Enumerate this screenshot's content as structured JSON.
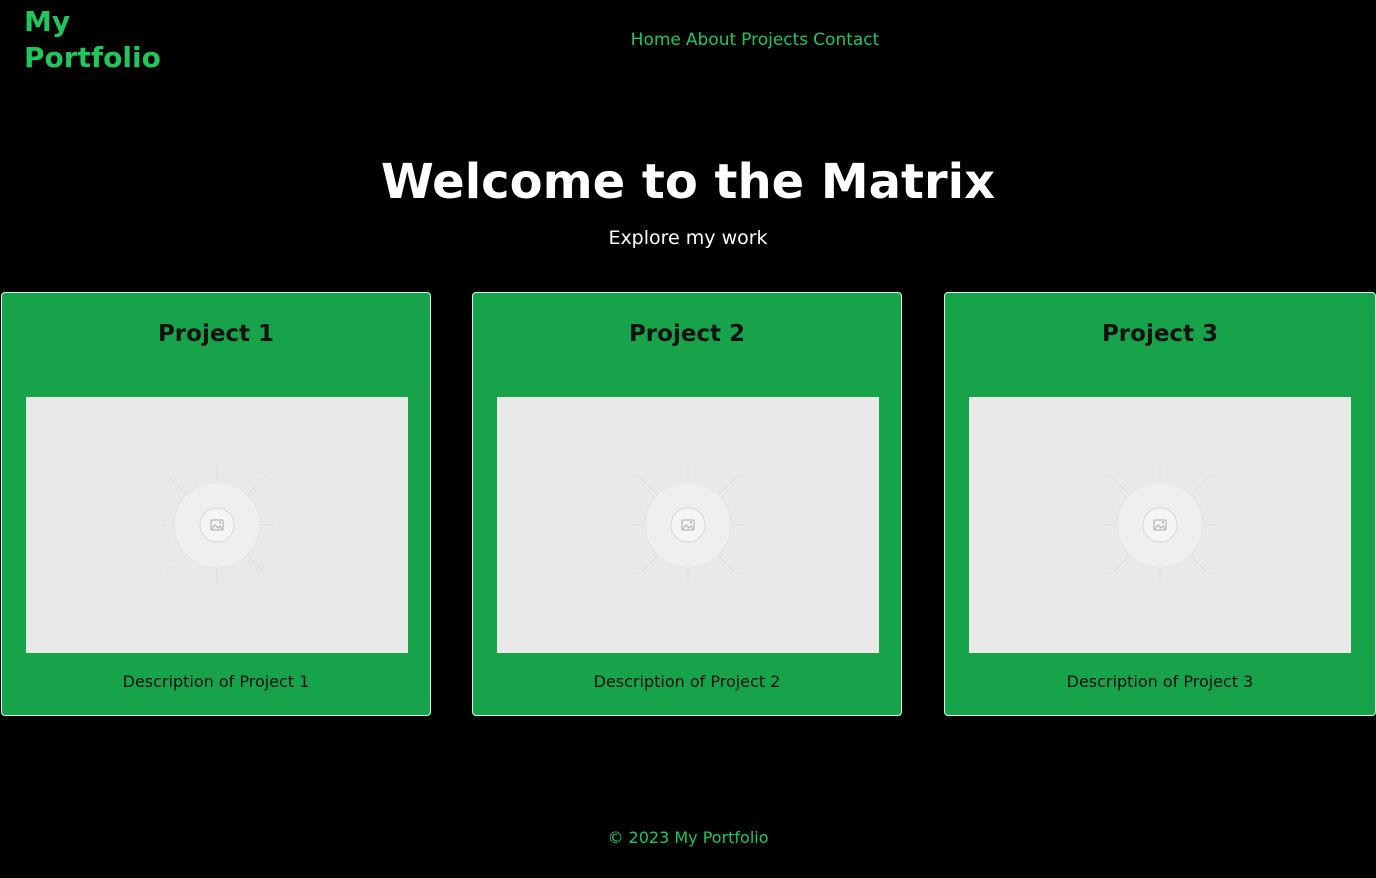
{
  "header": {
    "logo": "My Portfolio",
    "nav": [
      {
        "label": "Home"
      },
      {
        "label": "About"
      },
      {
        "label": "Projects"
      },
      {
        "label": "Contact"
      }
    ]
  },
  "hero": {
    "title": "Welcome to the Matrix",
    "subtitle": "Explore my work"
  },
  "projects": [
    {
      "title": "Project 1",
      "image_icon": "image-placeholder-icon",
      "description": "Description of Project 1"
    },
    {
      "title": "Project 2",
      "image_icon": "image-placeholder-icon",
      "description": "Description of Project 2"
    },
    {
      "title": "Project 3",
      "image_icon": "image-placeholder-icon",
      "description": "Description of Project 3"
    }
  ],
  "footer": {
    "text": "© 2023 My Portfolio"
  },
  "colors": {
    "background": "#000000",
    "accent": "#22c55e",
    "card": "#16a34a",
    "placeholder": "#e9e9e9"
  }
}
